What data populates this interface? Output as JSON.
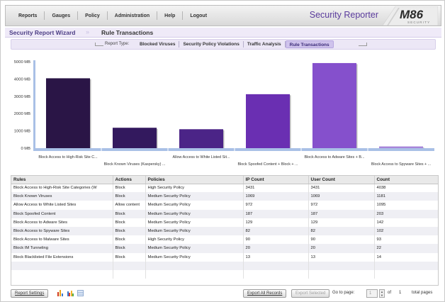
{
  "nav": {
    "items": [
      "Reports",
      "Gauges",
      "Policy",
      "Administration",
      "Help",
      "Logout"
    ]
  },
  "brand": {
    "title": "Security Reporter",
    "logo_text": "M86",
    "logo_sub": "SECURITY",
    "accent_color": "#5a3b9c"
  },
  "wizard": {
    "title": "Security Report Wizard",
    "step": "Rule Transactions"
  },
  "report_type": {
    "label": "Report Type:",
    "tabs": [
      "Blocked Viruses",
      "Security Policy Violations",
      "Traffic Analysis",
      "Rule Transactions"
    ],
    "active_index": 3
  },
  "chart_data": {
    "type": "bar",
    "title": "",
    "xlabel": "",
    "ylabel": "",
    "ylim": [
      0,
      5000
    ],
    "yticks": [
      "5000 MB",
      "4000 MB",
      "3000 MB",
      "2000 MB",
      "1000 MB",
      "0 MB"
    ],
    "categories": [
      "Block Access to High-Risk Site C...",
      "Block Known Viruses (Kaspersky) ...",
      "Allow Access to White Listed Sit...",
      "Block Spoofed Content + Block + ...",
      "Block Access to Adware Sites + B...",
      "Block Access to Spyware Sites + ..."
    ],
    "values": [
      4040,
      1180,
      1095,
      3120,
      4920,
      100
    ],
    "colors": [
      "#2a1546",
      "#33195e",
      "#4b2487",
      "#6a2fb2",
      "#8550cc",
      "#a685da"
    ],
    "grid": false
  },
  "table": {
    "columns": [
      "Rules",
      "Actions",
      "Policies",
      "IP Count",
      "User Count",
      "Count"
    ],
    "rows": [
      [
        "Block Access to High-Risk Site Categories (W",
        "Block",
        "High Security Policy",
        "3431",
        "3431",
        "4038"
      ],
      [
        "Block Known Viruses",
        "Block",
        "Medium Security Policy",
        "1069",
        "1069",
        "1181"
      ],
      [
        "Allow Access to White Listed Sites",
        "Allow content",
        "Medium Security Policy",
        "972",
        "972",
        "1095"
      ],
      [
        "Block Spoofed Content",
        "Block",
        "Medium Security Policy",
        "187",
        "187",
        "203"
      ],
      [
        "Block Access to Adware Sites",
        "Block",
        "Medium Security Policy",
        "129",
        "129",
        "142"
      ],
      [
        "Block Access to Spyware Sites",
        "Block",
        "Medium Security Policy",
        "82",
        "82",
        "102"
      ],
      [
        "Block Access to Malware Sites",
        "Block",
        "High Security Policy",
        "90",
        "90",
        "93"
      ],
      [
        "Block IM Tunneling",
        "Block",
        "Medium Security Policy",
        "20",
        "20",
        "22"
      ],
      [
        "Block Blacklisted File Extensions",
        "Block",
        "Medium Security Policy",
        "13",
        "13",
        "14"
      ]
    ]
  },
  "footer": {
    "report_settings": "Report Settings",
    "export_all": "Export All Records",
    "export_selected": "Export Selected",
    "goto_label": "Go to page:",
    "page_value": "1",
    "of_label": "of",
    "total_pages": "1",
    "total_label": "total pages"
  }
}
